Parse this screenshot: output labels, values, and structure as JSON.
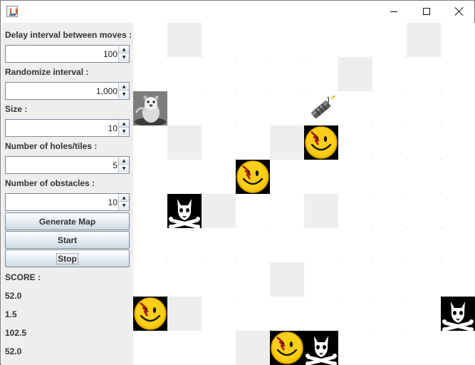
{
  "window": {
    "icon": "java-cup-icon",
    "controls": {
      "minimize": "minimize-icon",
      "maximize": "maximize-icon",
      "close": "close-icon"
    }
  },
  "settings": {
    "delay": {
      "label": "Delay interval between moves :",
      "value": "100"
    },
    "randomize": {
      "label": "Randomize interval :",
      "value": "1,000"
    },
    "size": {
      "label": "Size :",
      "value": "10"
    },
    "holes": {
      "label": "Number of holes/tiles :",
      "value": "5"
    },
    "obstacles": {
      "label": "Number of obstacles :",
      "value": "10"
    }
  },
  "buttons": {
    "generate": "Generate Map",
    "start": "Start",
    "stop": "Stop"
  },
  "score": {
    "label": "SCORE :",
    "values": [
      "52.0",
      "1.5",
      "102.5",
      "52.0"
    ]
  },
  "board": {
    "grid_size": 10,
    "tiles": [
      [
        1,
        0
      ],
      [
        8,
        0
      ],
      [
        6,
        1
      ],
      [
        1,
        3
      ],
      [
        4,
        3
      ],
      [
        2,
        5
      ],
      [
        5,
        5
      ],
      [
        4,
        7
      ],
      [
        1,
        8
      ],
      [
        3,
        9
      ]
    ],
    "agents": [
      {
        "kind": "gopher",
        "icon": "gopher-icon",
        "col": 0,
        "row": 2
      },
      {
        "kind": "dynamite",
        "icon": "dynamite-icon",
        "col": 5,
        "row": 2
      },
      {
        "kind": "smiley",
        "icon": "smiley-icon",
        "col": 5,
        "row": 3
      },
      {
        "kind": "smiley",
        "icon": "smiley-icon",
        "col": 3,
        "row": 4
      },
      {
        "kind": "skull",
        "icon": "skull-crossbones-icon",
        "col": 1,
        "row": 5
      },
      {
        "kind": "smiley",
        "icon": "smiley-icon",
        "col": 0,
        "row": 8
      },
      {
        "kind": "skull",
        "icon": "skull-crossbones-icon",
        "col": 9,
        "row": 8
      },
      {
        "kind": "smiley",
        "icon": "smiley-icon",
        "col": 4,
        "row": 9
      },
      {
        "kind": "skull",
        "icon": "skull-crossbones-icon",
        "col": 5,
        "row": 9
      }
    ]
  }
}
